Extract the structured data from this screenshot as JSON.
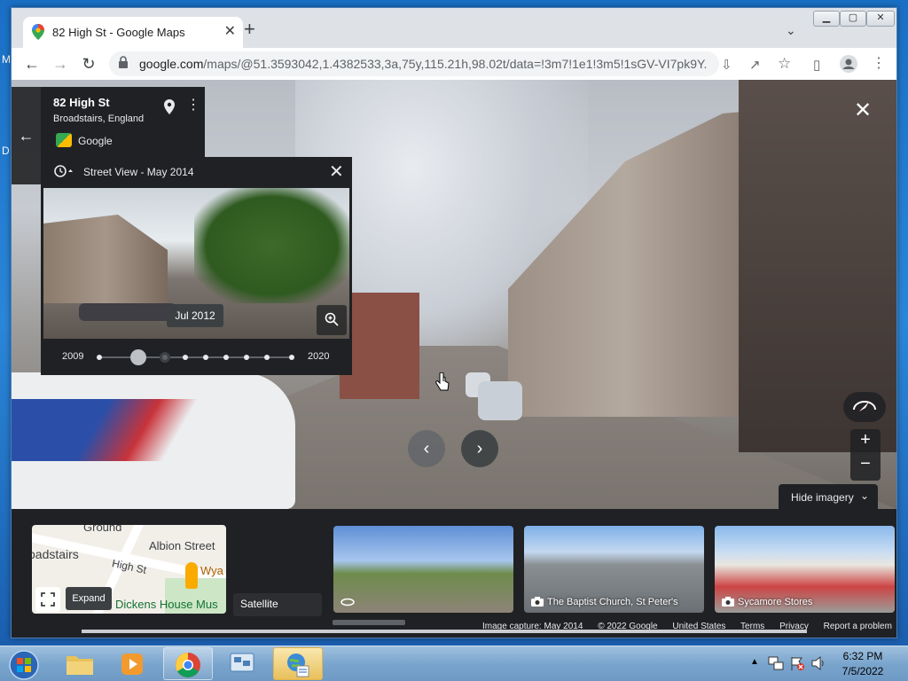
{
  "browser": {
    "tab_title": "82 High St - Google Maps",
    "url_host": "google.com",
    "url_path": "/maps/@51.3593042,1.4382533,3a,75y,115.21h,98.02t/data=!3m7!1e1!3m5!1sGV-VI7pk9Y..."
  },
  "place": {
    "name": "82 High St",
    "locality": "Broadstairs, England",
    "source": "Google"
  },
  "time_machine": {
    "header": "Street View - May 2014",
    "tooltip": "Jul 2012",
    "start_year": "2009",
    "end_year": "2020"
  },
  "street_view": {
    "hide_imagery": "Hide imagery"
  },
  "bottom": {
    "map_labels": [
      "Ground",
      "oadstairs",
      "Albion Street",
      "High St",
      "Dickens House Mus",
      "Wya"
    ],
    "expand": "Expand",
    "satellite": "Satellite",
    "photos": [
      {
        "caption": ""
      },
      {
        "caption": "The Baptist Church, St Peter's"
      },
      {
        "caption": "Sycamore Stores"
      }
    ]
  },
  "footer": {
    "image_capture": "Image capture: May 2014",
    "copyright": "© 2022 Google",
    "region": "United States",
    "terms": "Terms",
    "privacy": "Privacy",
    "report": "Report a problem"
  },
  "desktop_peek": [
    "M",
    "D"
  ],
  "taskbar": {
    "time": "6:32 PM",
    "date": "7/5/2022"
  },
  "colors": {
    "accent_blue": "#1a73e8",
    "panel_dark": "#202124"
  }
}
